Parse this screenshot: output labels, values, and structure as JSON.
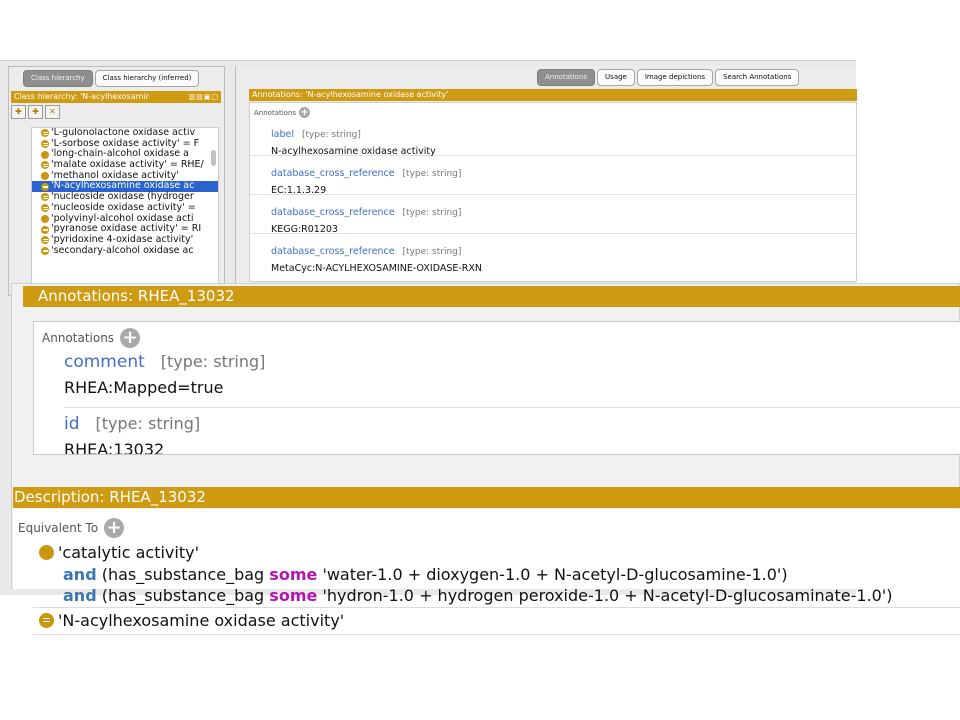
{
  "left_panel": {
    "tabs": [
      "Class hierarchy",
      "Class hierarchy (inferred)"
    ],
    "header": "Class hierarchy: 'N-acylhexosamir",
    "toolbar_icons": [
      "add-subclass-icon",
      "add-sibling-icon",
      "delete-class-icon"
    ],
    "tree_items": [
      {
        "label": "'L-gulonolactone oxidase activ",
        "selected": false
      },
      {
        "label": "'L-sorbose oxidase activity' = F",
        "selected": false
      },
      {
        "label": "'long-chain-alcohol oxidase a",
        "selected": false
      },
      {
        "label": "'malate oxidase activity' = RHE/",
        "selected": false
      },
      {
        "label": "'methanol oxidase activity'",
        "selected": false
      },
      {
        "label": "'N-acylhexosamine oxidase ac",
        "selected": true
      },
      {
        "label": "'nucleoside oxidase (hydroger",
        "selected": false
      },
      {
        "label": "'nucleoside oxidase activity' =",
        "selected": false
      },
      {
        "label": "'polyvinyl-alcohol oxidase acti",
        "selected": false
      },
      {
        "label": "'pyranose oxidase activity' = RI",
        "selected": false
      },
      {
        "label": "'pyridoxine 4-oxidase activity'",
        "selected": false
      },
      {
        "label": "'secondary-alcohol oxidase ac",
        "selected": false
      }
    ]
  },
  "right_panel": {
    "tabs": [
      "Annotations",
      "Usage",
      "Image depictions",
      "Search Annotations"
    ],
    "active_tab": "Annotations",
    "header": "Annotations: 'N-acylhexosamine oxidase activity'",
    "annotations_label": "Annotations",
    "entries": [
      {
        "property": "label",
        "type": "[type: string]",
        "value": "N-acylhexosamine oxidase activity"
      },
      {
        "property": "database_cross_reference",
        "type": "[type: string]",
        "value": "EC:1.1.3.29"
      },
      {
        "property": "database_cross_reference",
        "type": "[type: string]",
        "value": "KEGG:R01203"
      },
      {
        "property": "database_cross_reference",
        "type": "[type: string]",
        "value": "MetaCyc:N-ACYLHEXOSAMINE-OXIDASE-RXN"
      }
    ]
  },
  "zoom_annotations": {
    "header": "Annotations: RHEA_13032",
    "annotations_label": "Annotations",
    "entries": [
      {
        "property": "comment",
        "type": "[type: string]",
        "value": "RHEA:Mapped=true"
      },
      {
        "property": "id",
        "type": "[type: string]",
        "value": "RHEA:13032"
      }
    ]
  },
  "description": {
    "header": "Description: RHEA_13032",
    "equivalent_label": "Equivalent To",
    "class_name": "'catalytic activity'",
    "restrictions": [
      {
        "keyword": "and",
        "property": "(has_substance_bag",
        "quantifier": "some",
        "filler": "'water-1.0 + dioxygen-1.0 + N-acetyl-D-glucosamine-1.0')"
      },
      {
        "keyword": "and",
        "property": "(has_substance_bag",
        "quantifier": "some",
        "filler": "'hydron-1.0 + hydrogen peroxide-1.0 + N-acetyl-D-glucosaminate-1.0')"
      }
    ],
    "second_expression": "'N-acylhexosamine oxidase activity'"
  },
  "colors": {
    "header_gold": "#cf9b13",
    "class_dot": "#c9960e",
    "property_blue": "#3f6ec9",
    "keyword_and": "#3c77b5",
    "keyword_some": "#b515b5",
    "selection_blue": "#2a63cf"
  }
}
